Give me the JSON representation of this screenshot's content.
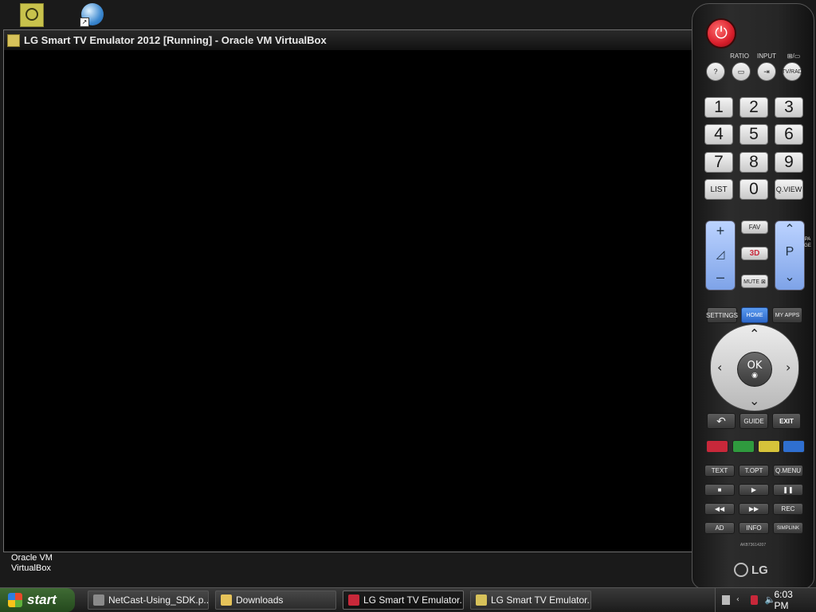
{
  "window": {
    "title": "LG Smart TV Emulator 2012 [Running] - Oracle VM VirtualBox"
  },
  "desktop": {
    "label_line1": "Oracle VM",
    "label_line2": "VirtualBox"
  },
  "remote": {
    "top_labels": {
      "ratio": "RATIO",
      "input": "INPUT",
      "tv_rad_top": "⊞/▭"
    },
    "top_keys": [
      "?",
      "▭",
      "⇥",
      "TV/RAD"
    ],
    "numbers": [
      "1",
      "2",
      "3",
      "4",
      "5",
      "6",
      "7",
      "8",
      "9"
    ],
    "list": "LIST",
    "zero": "0",
    "qview": "Q.VIEW",
    "vol_plus": "+",
    "vol_icon": "◿",
    "vol_minus": "–",
    "fav": "FAV",
    "three_d": "3D",
    "mute": "MUTE ⊠",
    "ch_up": "⌃",
    "ch_p": "P",
    "ch_down": "⌄",
    "page_label": "PAGE",
    "settings": "SETTINGS",
    "home": "HOME",
    "my_apps": "MY APPS",
    "ok": "OK",
    "back": "↶",
    "guide": "GUIDE",
    "exit": "EXIT",
    "text": "TEXT",
    "topt": "T.OPT",
    "qmenu": "Q.MENU",
    "stop": "■",
    "play": "▶",
    "pause": "❚❚",
    "rew": "◀◀",
    "ff": "▶▶",
    "rec": "REC",
    "ad": "AD",
    "info": "INFO",
    "simplink": "SIMPLINK",
    "model": "AKB73614207",
    "brand": "LG",
    "colors": {
      "red": "#c8283a",
      "green": "#2f9a3e",
      "yellow": "#d6c33a",
      "blue": "#2f6fd0",
      "power": "#d81e2b"
    }
  },
  "taskbar": {
    "start": "start",
    "items": [
      {
        "label": "NetCast-Using_SDK.p...",
        "active": false
      },
      {
        "label": "Downloads",
        "active": false
      },
      {
        "label": "LG Smart TV Emulator...",
        "active": true
      },
      {
        "label": "LG Smart TV Emulator...",
        "active": false
      }
    ],
    "clock": "6:03 PM"
  }
}
